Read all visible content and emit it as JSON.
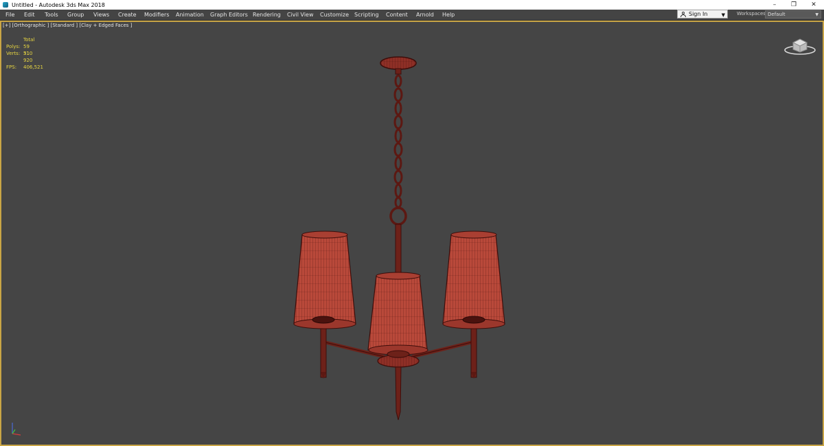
{
  "window": {
    "title": "Untitled - Autodesk 3ds Max 2018",
    "controls": [
      "–",
      "❐",
      "✕"
    ]
  },
  "menu": {
    "items": [
      "File",
      "Edit",
      "Tools",
      "Group",
      "Views",
      "Create",
      "Modifiers",
      "Animation",
      "Graph Editors",
      "Rendering",
      "Civil View",
      "Customize",
      "Scripting",
      "Content",
      "Arnold",
      "Help"
    ]
  },
  "account": {
    "signin_label": "Sign In"
  },
  "workspaces": {
    "label": "Workspaces:",
    "value": "Default"
  },
  "viewport": {
    "label": "[+] [Orthographic ] [Standard ] [Clay + Edged Faces ]",
    "stats": {
      "header": "Total",
      "polys_label": "Polys:",
      "polys_value": "59 510",
      "verts_label": "Verts:",
      "verts_value": "31 920",
      "fps_label": "FPS:",
      "fps_value": "406,521"
    }
  },
  "colors": {
    "viewport_bg": "#454545",
    "viewport_border": "#c9a545",
    "stats_text": "#e8d641",
    "model_fill": "#b9493a",
    "model_wire": "#3d0d0a"
  },
  "icons": {
    "app": "3dsmax-app-icon",
    "viewcube": "viewcube-icon",
    "axis": "axis-tripod-icon",
    "user": "user-icon"
  }
}
